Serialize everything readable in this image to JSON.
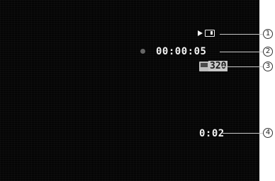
{
  "screen": {
    "timecode": "00:00:05",
    "resolution": "320",
    "remaining_time": "0:02"
  },
  "icons": {
    "playback_card": "play-card-icon",
    "record_dot": "record-dot-icon",
    "movie_size": "film-icon"
  },
  "callouts": [
    "1",
    "2",
    "3",
    "4"
  ],
  "colors": {
    "screen_bg": "#050505",
    "osd_text": "#f2f2f2",
    "badge_bg": "#c7c7c7"
  }
}
